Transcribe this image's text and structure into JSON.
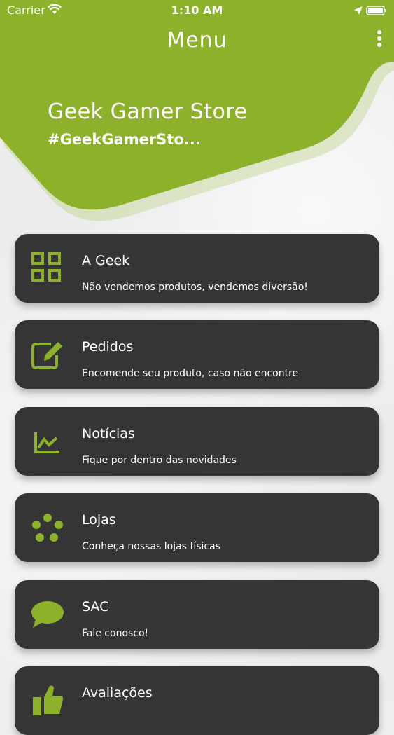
{
  "status_bar": {
    "carrier": "Carrier",
    "time": "1:10 AM"
  },
  "header": {
    "title": "Menu"
  },
  "store": {
    "name": "Geek Gamer Store",
    "tagline": "#GeekGamerSto..."
  },
  "colors": {
    "accent": "#8db12a",
    "card": "#353535"
  },
  "menu": [
    {
      "title": "A Geek",
      "subtitle": "Não vendemos produtos, vendemos diversão!",
      "icon": "grid-icon"
    },
    {
      "title": "Pedidos",
      "subtitle": "Encomende seu produto, caso não encontre",
      "icon": "edit-icon"
    },
    {
      "title": "Notícias",
      "subtitle": "Fique por dentro das novidades",
      "icon": "chart-line-icon"
    },
    {
      "title": "Lojas",
      "subtitle": "Conheça nossas lojas físicas",
      "icon": "dots-circle-icon"
    },
    {
      "title": "SAC",
      "subtitle": "Fale conosco!",
      "icon": "chat-bubble-icon"
    },
    {
      "title": "Avaliações",
      "subtitle": "",
      "icon": "thumbs-up-icon"
    }
  ]
}
